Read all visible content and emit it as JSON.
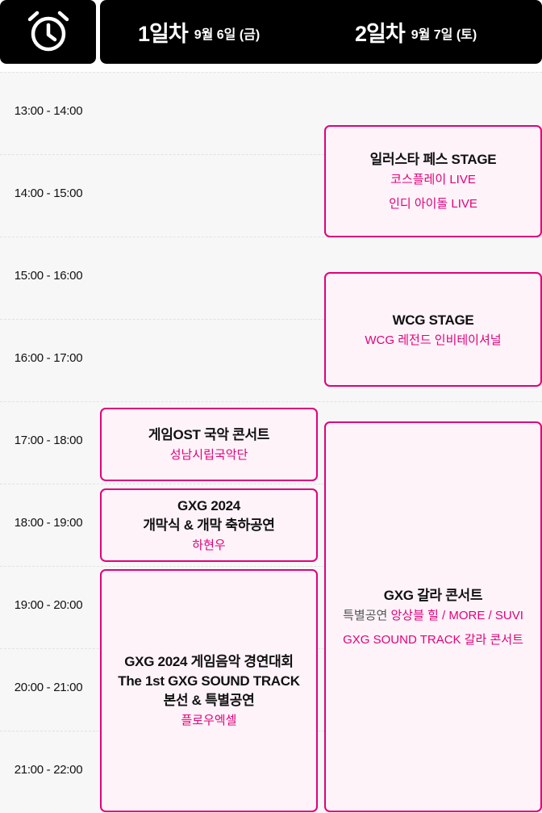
{
  "header": {
    "clock_icon": "alarm-clock-icon",
    "day1": {
      "label": "1일차",
      "date": "9월 6일 (금)"
    },
    "day2": {
      "label": "2일차",
      "date": "9월 7일 (토)"
    }
  },
  "time_slots": [
    "13:00 - 14:00",
    "14:00 - 15:00",
    "15:00 - 16:00",
    "16:00 - 17:00",
    "17:00 - 18:00",
    "18:00 - 19:00",
    "19:00 - 20:00",
    "20:00 - 21:00",
    "21:00 - 22:00"
  ],
  "day1_events": [
    {
      "title_lines": [
        "게임OST 국악 콘서트"
      ],
      "performer": "성남시립국악단"
    },
    {
      "title_lines": [
        "GXG 2024",
        "개막식 & 개막 축하공연"
      ],
      "performer": "하현우"
    },
    {
      "title_lines": [
        "GXG 2024 게임음악 경연대회",
        "The 1st GXG SOUND TRACK",
        "본선 & 특별공연"
      ],
      "performer": "플로우엑셀"
    }
  ],
  "day2_events": [
    {
      "title": "일러스타 페스 STAGE",
      "subs": [
        "코스플레이 LIVE",
        "인디 아이돌 LIVE"
      ]
    },
    {
      "title": "WCG STAGE",
      "subs": [
        "WCG 레전드 인비테이셔널"
      ]
    },
    {
      "title": "GXG 갈라 콘서트",
      "special_prefix": "특별공연",
      "special_names": "앙상블 힐 / MORE / SUVI",
      "subs": [
        "GXG SOUND TRACK 갈라 콘서트"
      ]
    }
  ],
  "colors": {
    "accent": "#e2007a",
    "header_bg": "#000000",
    "event_bg": "#fff3fa",
    "schedule_bg": "#f7f7f7"
  }
}
